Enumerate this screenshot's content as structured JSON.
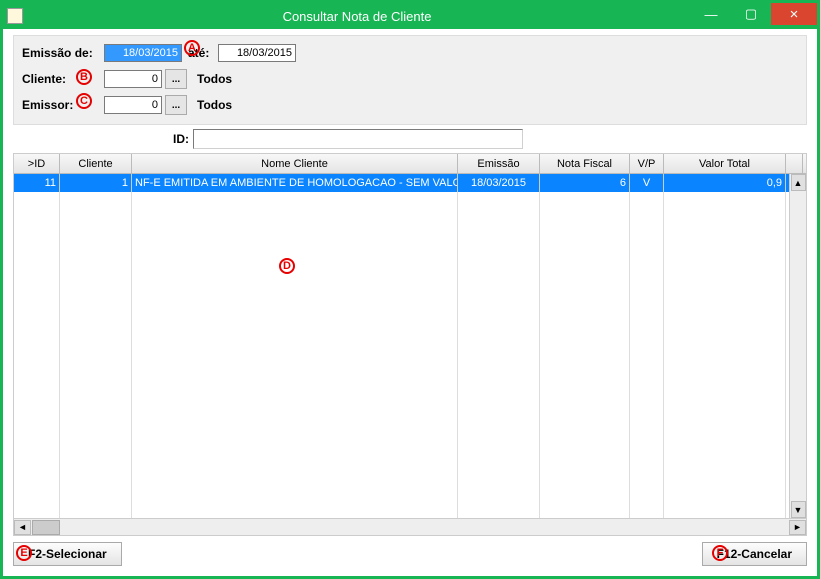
{
  "window": {
    "title": "Consultar Nota de Cliente",
    "min": "—",
    "max": "▢",
    "close": "×"
  },
  "filters": {
    "emissao_label": "Emissão de:",
    "emissao_de": "18/03/2015",
    "ate_label": "até:",
    "emissao_ate": "18/03/2015",
    "cliente_label": "Cliente:",
    "cliente_value": "0",
    "cliente_todos": "Todos",
    "emissor_label": "Emissor:",
    "emissor_value": "0",
    "emissor_todos": "Todos",
    "lookup": "..."
  },
  "id": {
    "label": "ID:"
  },
  "grid": {
    "headers": {
      "id": ">ID",
      "cliente": "Cliente",
      "nome": "Nome Cliente",
      "emissao": "Emissão",
      "nota": "Nota Fiscal",
      "vp": "V/P",
      "valor": "Valor Total"
    },
    "row": {
      "id": "11",
      "cliente": "1",
      "nome": "NF-E EMITIDA EM AMBIENTE DE HOMOLOGACAO - SEM VALO",
      "emissao": "18/03/2015",
      "nota": "6",
      "vp": "V",
      "valor": "0,9"
    }
  },
  "scroll": {
    "left": "◄",
    "right": "►",
    "up": "▲",
    "down": "▼"
  },
  "buttons": {
    "select": "F2-Selecionar",
    "cancel": "F12-Cancelar"
  },
  "markers": {
    "a": "A",
    "b": "B",
    "c": "C",
    "d": "D",
    "e": "E",
    "f": "F"
  }
}
